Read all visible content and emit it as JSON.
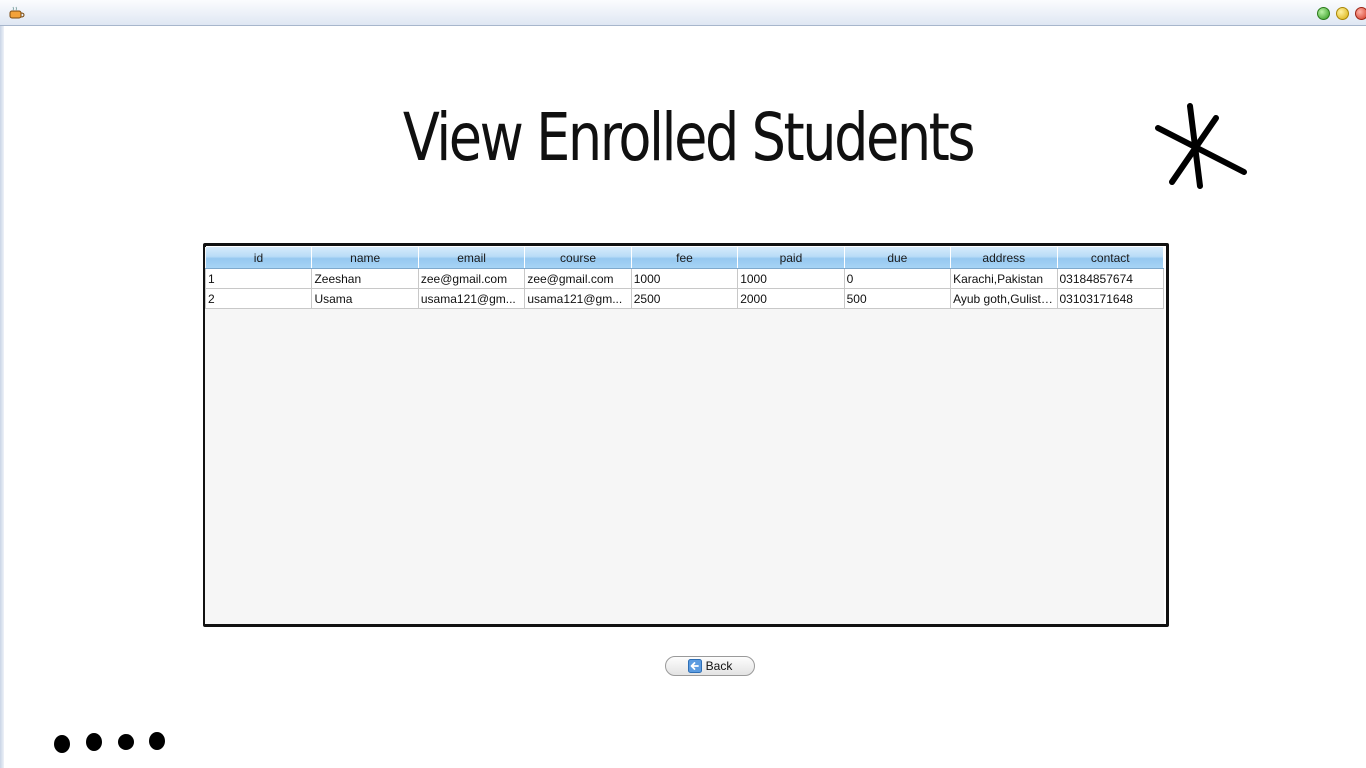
{
  "window": {
    "controls": [
      "maximize-button",
      "minimize-button",
      "close-button"
    ]
  },
  "page": {
    "title": "View Enrolled Students"
  },
  "table": {
    "columns": [
      "id",
      "name",
      "email",
      "course",
      "fee",
      "paid",
      "due",
      "address",
      "contact"
    ],
    "rows": [
      [
        "1",
        "Zeeshan",
        "zee@gmail.com",
        "zee@gmail.com",
        "1000",
        "1000",
        "0",
        "Karachi,Pakistan",
        "03184857674"
      ],
      [
        "2",
        "Usama",
        "usama121@gm...",
        "usama121@gm...",
        "2500",
        "2000",
        "500",
        "Ayub goth,Gulista...",
        "03103171648"
      ]
    ]
  },
  "actions": {
    "back_label": "Back",
    "back_icon": "back-arrow-icon"
  },
  "colors": {
    "header_top": "#d6ebfb",
    "header_bottom": "#96c8f0",
    "table_bg": "#f6f6f6"
  }
}
